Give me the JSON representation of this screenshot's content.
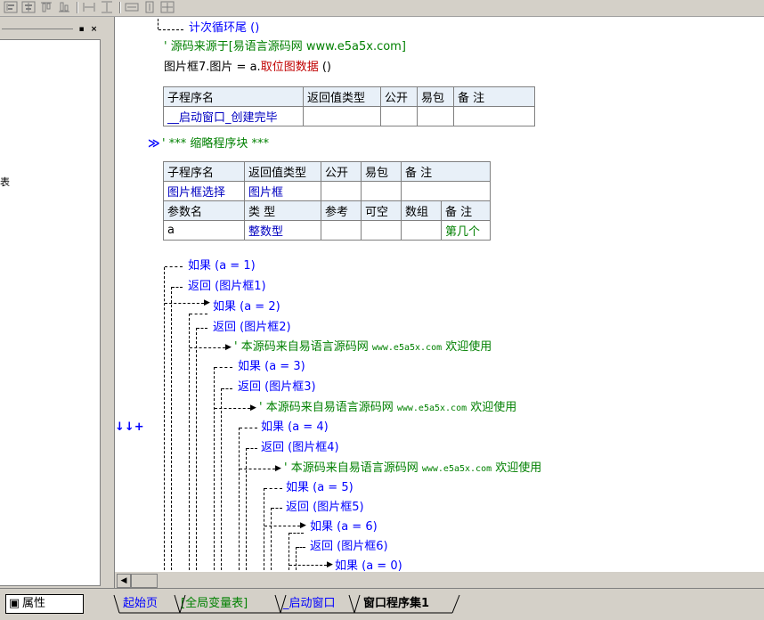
{
  "toolbar": {
    "icons": [
      "align-left-icon",
      "align-center-icon",
      "align-top-icon",
      "align-bottom-icon",
      "spacing-horizontal-icon",
      "spacing-vertical-icon",
      "same-width-icon",
      "same-height-icon",
      "same-size-icon"
    ]
  },
  "left_panel": {
    "minimize": "▪",
    "close": "×",
    "glyph": "表"
  },
  "code": {
    "line1": "计次循环尾 ()",
    "line2": "' 源码来源于[易语言源码网 www.e5a5x.com]",
    "line3_obj": "图片框7.图片",
    "line3_eq": " = ",
    "line3_a": "a.",
    "line3_fn": "取位图数据",
    "line3_paren": " ()",
    "collapsed_marker": "≫",
    "collapsed_label": "' *** 缩略程序块 ***",
    "if1": "如果 (a = 1)",
    "ret1": "返回 (图片框1)",
    "if2": "如果 (a = 2)",
    "ret2": "返回 (图片框2)",
    "cmt": "' 本源码来自易语言源码网 www.e5a5x.com  欢迎使用",
    "if3": "如果 (a = 3)",
    "ret3": "返回 (图片框3)",
    "if4": "如果 (a = 4)",
    "ret4": "返回 (图片框4)",
    "if5": "如果 (a = 5)",
    "ret5": "返回 (图片框5)",
    "if6": "如果 (a = 6)",
    "ret6": "返回 (图片框6)",
    "if0": "如果 (a = 0)",
    "gutter_marker": "↓↓+"
  },
  "table1": {
    "headers": [
      "子程序名",
      "返回值类型",
      "公开",
      "易包",
      "备 注"
    ],
    "row": [
      "__启动窗口_创建完毕",
      "",
      "",
      "",
      ""
    ]
  },
  "table2": {
    "headers": [
      "子程序名",
      "返回值类型",
      "公开",
      "易包",
      "备 注"
    ],
    "row": [
      "图片框选择",
      "图片框",
      "",
      "",
      ""
    ],
    "param_headers": [
      "参数名",
      "类 型",
      "参考",
      "可空",
      "数组",
      "备 注"
    ],
    "param_row": [
      "a",
      "整数型",
      "",
      "",
      "",
      "第几个"
    ]
  },
  "tabs": {
    "properties": "属性",
    "start_page": "起始页",
    "globals": "[全局变量表]",
    "startup_window": "_启动窗口",
    "program_set": "窗口程序集1"
  },
  "colors": {
    "keyword": "#0000ff",
    "comment": "#008000",
    "link": "#0000c0",
    "function": "#c00000"
  }
}
